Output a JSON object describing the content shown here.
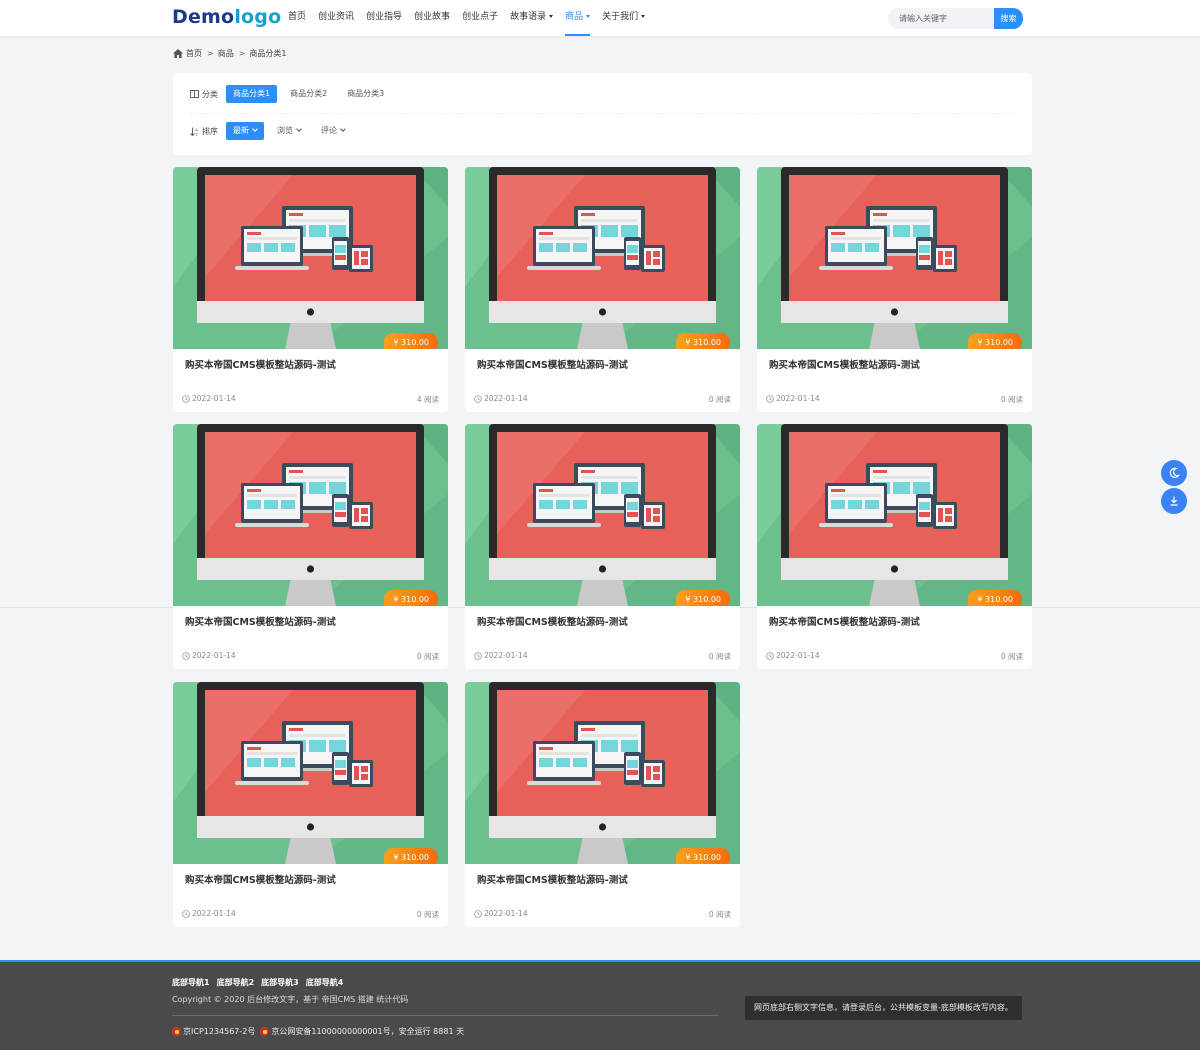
{
  "header": {
    "logo_part1": "Demo",
    "logo_part2": "logo",
    "nav": [
      {
        "label": "首页"
      },
      {
        "label": "创业资讯"
      },
      {
        "label": "创业指导"
      },
      {
        "label": "创业故事"
      },
      {
        "label": "创业点子"
      },
      {
        "label": "故事语录"
      },
      {
        "label": "商品"
      },
      {
        "label": "关于我们"
      }
    ],
    "search_placeholder": "请输入关键字",
    "search_button": "搜索"
  },
  "breadcrumb": {
    "items": [
      "首页",
      "商品",
      "商品分类1"
    ],
    "separator": ">"
  },
  "filter": {
    "category_label": "分类",
    "categories": [
      "商品分类1",
      "商品分类2",
      "商品分类3"
    ],
    "sort_label": "排序",
    "sorts": [
      "最新",
      "浏览",
      "评论"
    ]
  },
  "products": [
    {
      "title": "购买本帝国CMS模板整站源码-测试",
      "price": "¥ 310.00",
      "date": "2022-01-14",
      "views": "4 阅读"
    },
    {
      "title": "购买本帝国CMS模板整站源码-测试",
      "price": "¥ 310.00",
      "date": "2022-01-14",
      "views": "0 阅读"
    },
    {
      "title": "购买本帝国CMS模板整站源码-测试",
      "price": "¥ 310.00",
      "date": "2022-01-14",
      "views": "0 阅读"
    },
    {
      "title": "购买本帝国CMS模板整站源码-测试",
      "price": "¥ 310.00",
      "date": "2022-01-14",
      "views": "0 阅读"
    },
    {
      "title": "购买本帝国CMS模板整站源码-测试",
      "price": "¥ 310.00",
      "date": "2022-01-14",
      "views": "0 阅读"
    },
    {
      "title": "购买本帝国CMS模板整站源码-测试",
      "price": "¥ 310.00",
      "date": "2022-01-14",
      "views": "0 阅读"
    },
    {
      "title": "购买本帝国CMS模板整站源码-测试",
      "price": "¥ 310.00",
      "date": "2022-01-14",
      "views": "0 阅读"
    },
    {
      "title": "购买本帝国CMS模板整站源码-测试",
      "price": "¥ 310.00",
      "date": "2022-01-14",
      "views": "0 阅读"
    }
  ],
  "footer": {
    "nav": [
      "底部导航1",
      "底部导航2",
      "底部导航3",
      "底部导航4"
    ],
    "copyright": "Copyright © 2020 后台修改文字，基于 帝国CMS 搭建 统计代码",
    "icp": "京ICP1234567-2号",
    "police": "京公网安备11000000000001号，安全运行 8881 天",
    "note": "网页底部右侧文字信息，请登录后台，公共模板变量-底部模板改写内容。"
  },
  "colors": {
    "accent": "#2a8ff7",
    "thumb_bg": "#6cc08d",
    "screen": "#e8605a",
    "price_orange": "#f47b14",
    "footer_bg": "#4a4a4a"
  },
  "icons": [
    "home-icon",
    "grid-icon",
    "sort-icon",
    "clock-icon",
    "moon-icon",
    "download-icon"
  ]
}
